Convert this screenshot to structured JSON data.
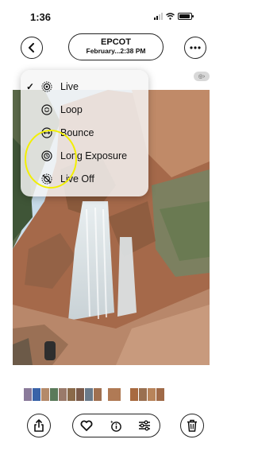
{
  "status_bar": {
    "time": "1:36",
    "battery_level": 0.9
  },
  "header": {
    "back_icon": "chevron-left-icon",
    "title": "EPCOT",
    "subtitle": "February...2:38 PM",
    "more_icon": "ellipsis-icon"
  },
  "live_badge": {
    "icon": "live-photo-icon",
    "chevron": "chevron-right-icon"
  },
  "menu": {
    "items": [
      {
        "label": "Live",
        "icon": "live-icon",
        "checked": true
      },
      {
        "label": "Loop",
        "icon": "loop-icon",
        "checked": false
      },
      {
        "label": "Bounce",
        "icon": "bounce-icon",
        "checked": false
      },
      {
        "label": "Long Exposure",
        "icon": "long-exposure-icon",
        "checked": false
      },
      {
        "label": "Live Off",
        "icon": "live-off-icon",
        "checked": false
      }
    ]
  },
  "highlight_color": "#f2ef00",
  "toolbar": {
    "share_icon": "share-icon",
    "favorite_icon": "heart-icon",
    "info_icon": "info-sparkle-icon",
    "adjust_icon": "adjust-sliders-icon",
    "delete_icon": "trash-icon"
  },
  "thumbnail_colors": [
    "#8a7a9a",
    "#3a63a8",
    "#b48a6a",
    "#5a7a5a",
    "#9a7a6a",
    "#8a6a4a",
    "#7a5a4a",
    "#6a7a8a",
    "#a07050",
    "#b07a55",
    "#a86a40",
    "#9a7050",
    "#b8845a",
    "#a06a48"
  ]
}
